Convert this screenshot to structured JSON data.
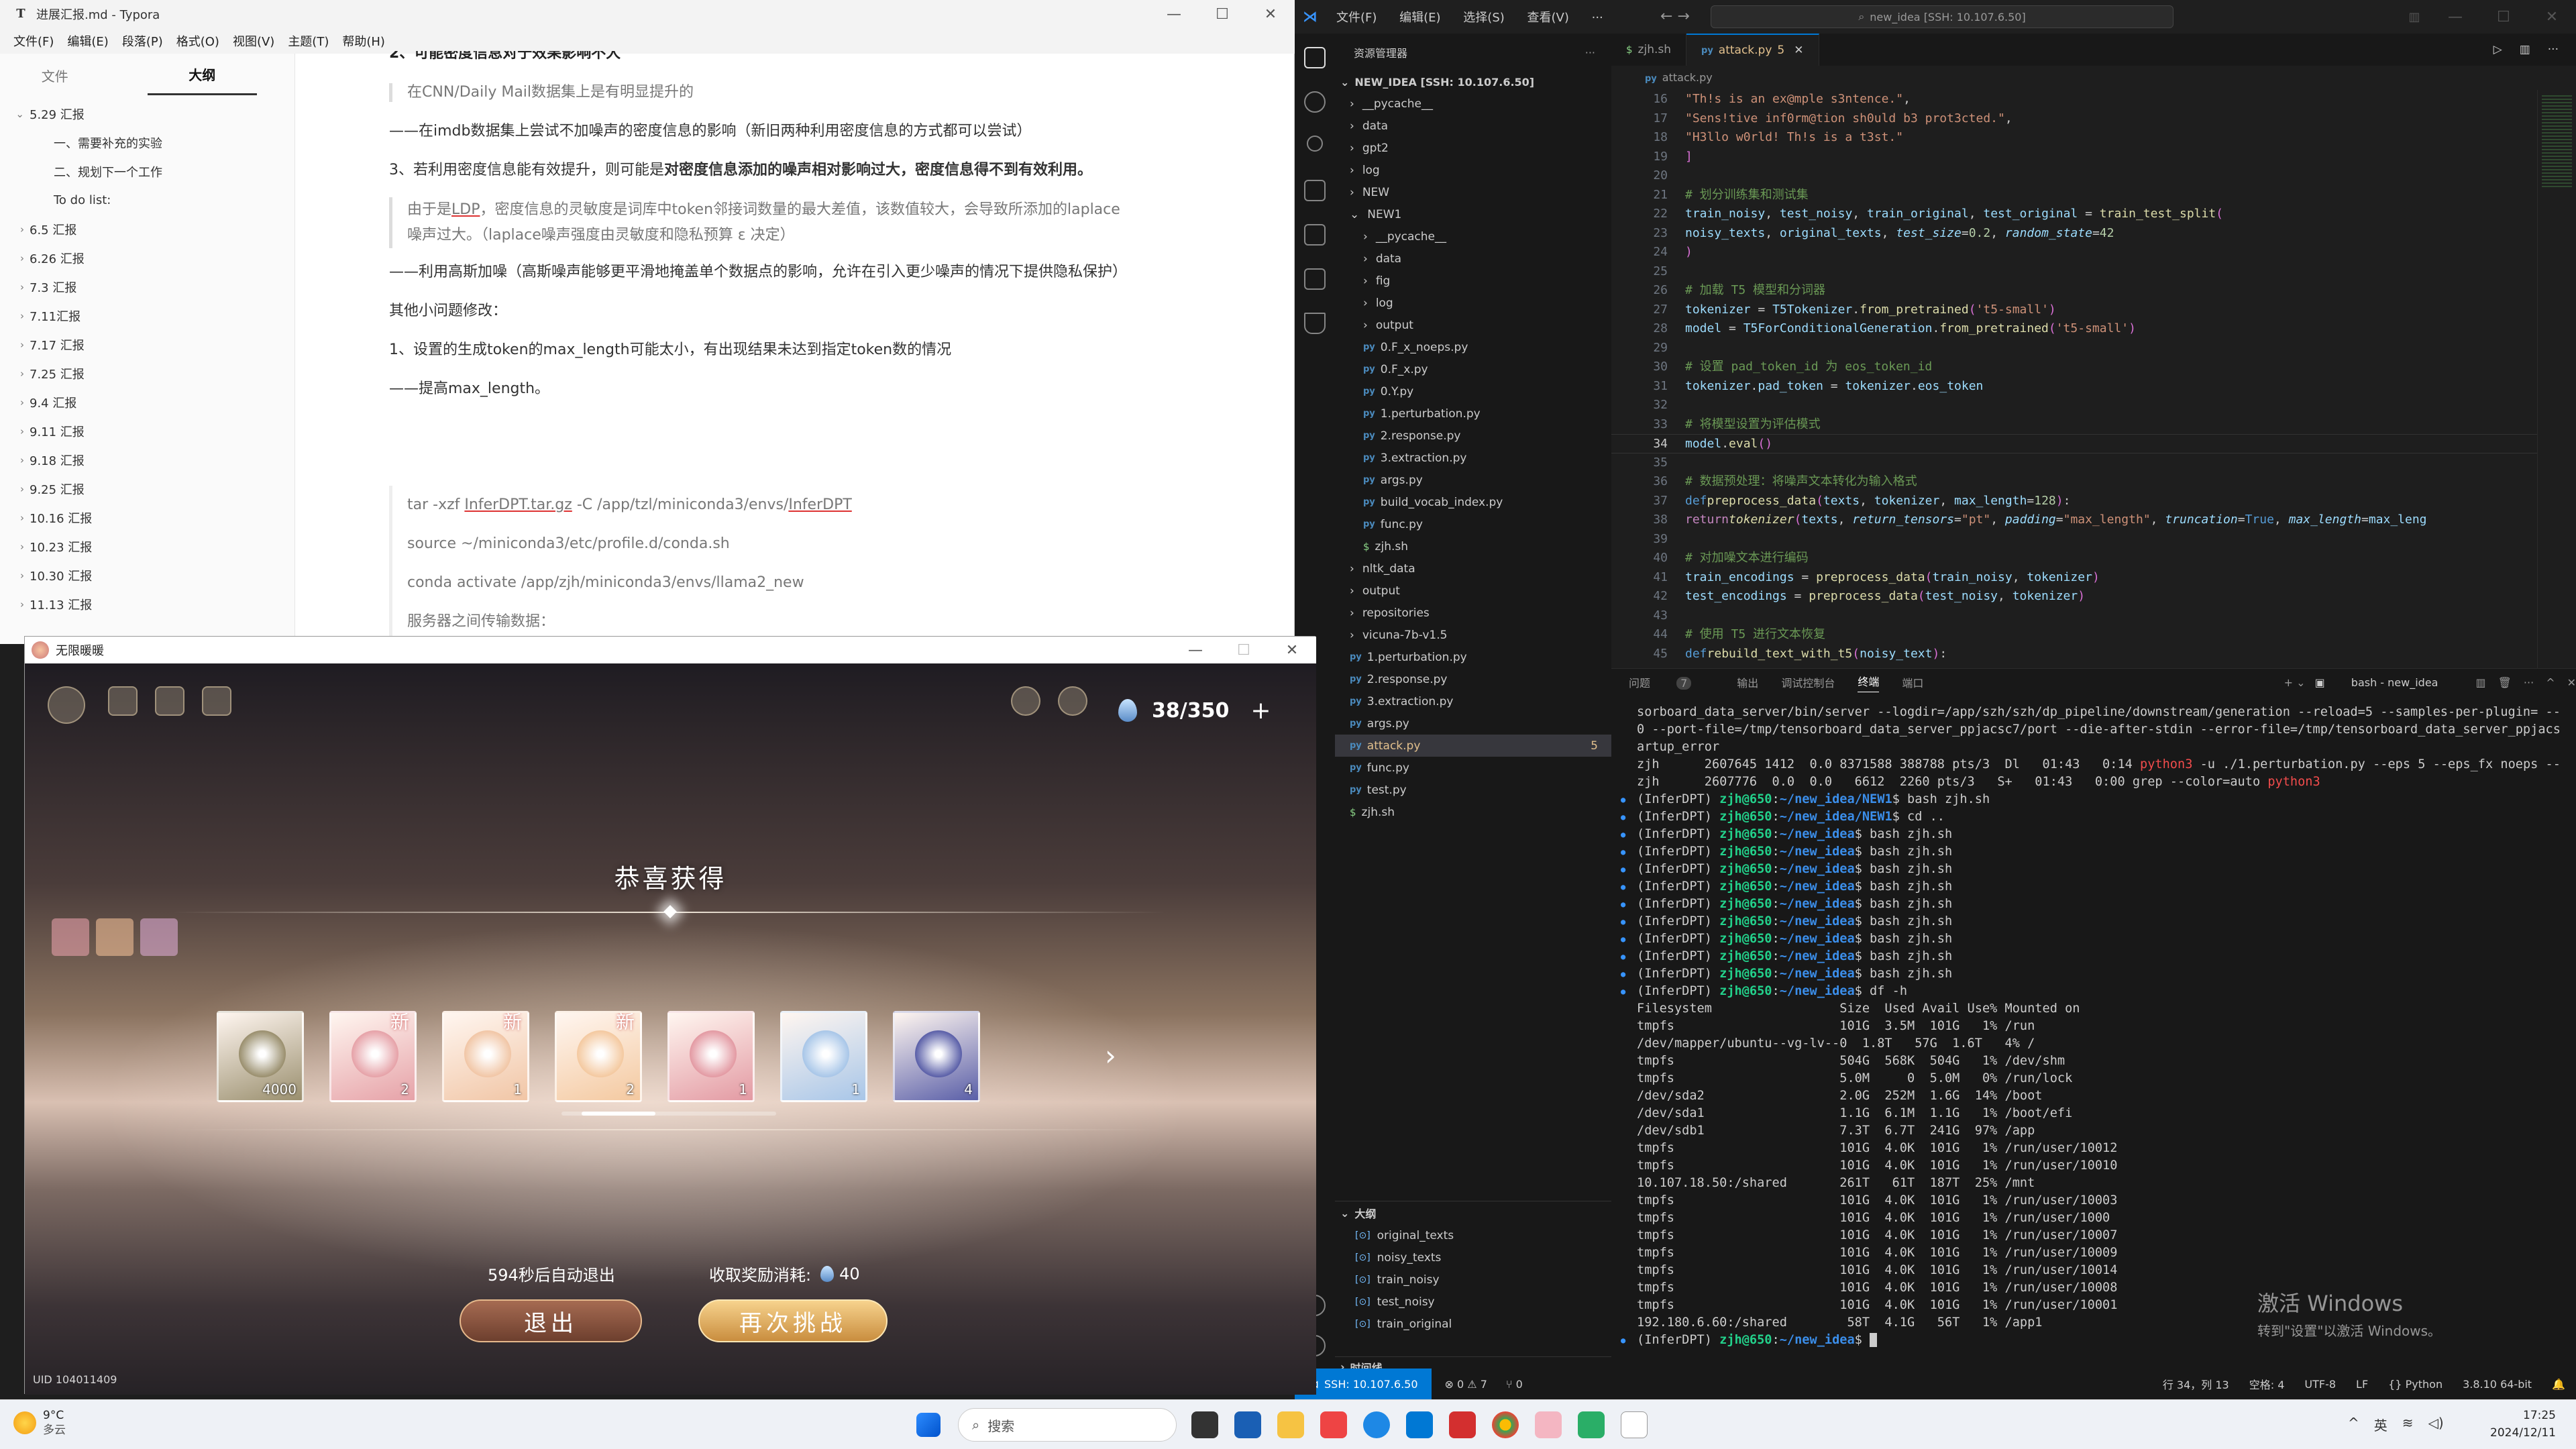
{
  "typora": {
    "title": "进展汇报.md - Typora",
    "menu": [
      "文件(F)",
      "编辑(E)",
      "段落(P)",
      "格式(O)",
      "视图(V)",
      "主题(T)",
      "帮助(H)"
    ],
    "tabs": {
      "files": "文件",
      "outline": "大纲"
    },
    "outline": [
      {
        "label": "5.29 汇报",
        "expanded": true
      },
      {
        "label": "一、需要补充的实验",
        "sub": true
      },
      {
        "label": "二、规划下一个工作",
        "sub": true
      },
      {
        "label": "To do list:",
        "sub": true,
        "plain": true
      },
      {
        "label": "6.5 汇报"
      },
      {
        "label": "6.26 汇报"
      },
      {
        "label": "7.3 汇报"
      },
      {
        "label": "7.11汇报"
      },
      {
        "label": "7.17 汇报"
      },
      {
        "label": "7.25 汇报"
      },
      {
        "label": "9.4 汇报"
      },
      {
        "label": "9.11 汇报"
      },
      {
        "label": "9.18 汇报"
      },
      {
        "label": "9.25 汇报"
      },
      {
        "label": "10.16 汇报"
      },
      {
        "label": "10.23 汇报"
      },
      {
        "label": "10.30 汇报"
      },
      {
        "label": "11.13 汇报"
      }
    ],
    "doc": {
      "h_partial": "2、可能密度信息对于效果影响不大",
      "q1": "在CNN/Daily Mail数据集上是有明显提升的",
      "p1": "——在imdb数据集上尝试不加噪声的密度信息的影响（新旧两种利用密度信息的方式都可以尝试）",
      "p2_a": "3、若利用密度信息能有效提升，则可能是",
      "p2_b": "对密度信息添加的噪声相对影响过大，密度信息得不到有效利用。",
      "q2_a": "由于是",
      "q2_ldp": "LDP",
      "q2_b": "，密度信息的灵敏度是词库中token邻接词数量的最大差值，该数值较大，会导致所添加的laplace",
      "q2_c": "噪声过大。（laplace噪声强度由灵敏度和隐私预算 ε 决定）",
      "p3": "——利用高斯加噪（高斯噪声能够更平滑地掩盖单个数据点的影响，允许在引入更少噪声的情况下提供隐私保护）",
      "p4": "其他小问题修改：",
      "p5": "1、设置的生成token的max_length可能太小，有出现结果未达到指定token数的情况",
      "p6": "——提高max_length。",
      "c1_a": "tar -xzf ",
      "c1_b": "InferDPT.tar.gz",
      "c1_c": " -C /app/tzl/miniconda3/envs/",
      "c1_d": "InferDPT",
      "c2": "source ~/miniconda3/etc/profile.d/conda.sh",
      "c3": "conda activate /app/zjh/miniconda3/envs/llama2_new",
      "c4": "服务器之间传输数据："
    }
  },
  "game": {
    "title": "无限暖暖",
    "energy": "38/350",
    "congrats": "恭喜获得",
    "items": [
      {
        "count": "4000",
        "new": false,
        "color": "#9a8f6e"
      },
      {
        "count": "2",
        "new": true,
        "color": "#e6a2a8"
      },
      {
        "count": "1",
        "new": true,
        "color": "#f1c6a6"
      },
      {
        "count": "2",
        "new": true,
        "color": "#f4c9a0"
      },
      {
        "count": "1",
        "new": false,
        "color": "#e39aa3"
      },
      {
        "count": "1",
        "new": false,
        "color": "#a8c6e8"
      },
      {
        "count": "4",
        "new": false,
        "color": "#5a5fa8"
      }
    ],
    "new_badge": "新",
    "auto_exit": "594秒后自动退出",
    "cost_label": "收取奖励消耗:",
    "cost_value": "40",
    "exit_btn": "退出",
    "retry_btn": "再次挑战",
    "uid": "UID 104011409"
  },
  "vscode": {
    "menu": [
      "文件(F)",
      "编辑(E)",
      "选择(S)",
      "查看(V)",
      "···"
    ],
    "search": "new_idea [SSH: 10.107.6.50]",
    "explorer_title": "资源管理器",
    "root": "NEW_IDEA [SSH: 10.107.6.50]",
    "tree": [
      {
        "name": "__pycache__",
        "type": "dir",
        "lvl": 0
      },
      {
        "name": "data",
        "type": "dir",
        "lvl": 0
      },
      {
        "name": "gpt2",
        "type": "dir",
        "lvl": 0
      },
      {
        "name": "log",
        "type": "dir",
        "lvl": 0
      },
      {
        "name": "NEW",
        "type": "dir",
        "lvl": 0
      },
      {
        "name": "NEW1",
        "type": "open",
        "lvl": 0
      },
      {
        "name": "__pycache__",
        "type": "dir",
        "lvl": 1
      },
      {
        "name": "data",
        "type": "dir",
        "lvl": 1
      },
      {
        "name": "fig",
        "type": "dir",
        "lvl": 1
      },
      {
        "name": "log",
        "type": "dir",
        "lvl": 1
      },
      {
        "name": "output",
        "type": "dir",
        "lvl": 1
      },
      {
        "name": "0.F_x_noeps.py",
        "type": "py",
        "lvl": 1
      },
      {
        "name": "0.F_x.py",
        "type": "py",
        "lvl": 1
      },
      {
        "name": "0.Y.py",
        "type": "py",
        "lvl": 1
      },
      {
        "name": "1.perturbation.py",
        "type": "py",
        "lvl": 1
      },
      {
        "name": "2.response.py",
        "type": "py",
        "lvl": 1
      },
      {
        "name": "3.extraction.py",
        "type": "py",
        "lvl": 1
      },
      {
        "name": "args.py",
        "type": "py",
        "lvl": 1
      },
      {
        "name": "build_vocab_index.py",
        "type": "py",
        "lvl": 1
      },
      {
        "name": "func.py",
        "type": "py",
        "lvl": 1
      },
      {
        "name": "zjh.sh",
        "type": "sh",
        "lvl": 1
      },
      {
        "name": "nltk_data",
        "type": "dir",
        "lvl": 0
      },
      {
        "name": "output",
        "type": "dir",
        "lvl": 0
      },
      {
        "name": "repositories",
        "type": "dir",
        "lvl": 0
      },
      {
        "name": "vicuna-7b-v1.5",
        "type": "dir",
        "lvl": 0
      },
      {
        "name": "1.perturbation.py",
        "type": "py",
        "lvl": 0
      },
      {
        "name": "2.response.py",
        "type": "py",
        "lvl": 0
      },
      {
        "name": "3.extraction.py",
        "type": "py",
        "lvl": 0
      },
      {
        "name": "args.py",
        "type": "py",
        "lvl": 0
      },
      {
        "name": "attack.py",
        "type": "py",
        "lvl": 0,
        "active": true,
        "badge": "5"
      },
      {
        "name": "func.py",
        "type": "py",
        "lvl": 0
      },
      {
        "name": "test.py",
        "type": "py",
        "lvl": 0
      },
      {
        "name": "zjh.sh",
        "type": "sh",
        "lvl": 0
      }
    ],
    "outline_title": "大纲",
    "outline": [
      "original_texts",
      "noisy_texts",
      "train_noisy",
      "test_noisy",
      "train_original"
    ],
    "timeline": "时间线",
    "tabs": [
      {
        "label": "zjh.sh"
      },
      {
        "label": "attack.py",
        "badge": "5",
        "active": true
      }
    ],
    "breadcrumb": "attack.py",
    "panel_tabs": [
      "问题",
      "输出",
      "调试控制台",
      "终端",
      "端口"
    ],
    "panel_badge": "7",
    "terminal_label": "bash - new_idea",
    "status": {
      "remote": "SSH: 10.107.6.50",
      "problems": "⊗ 0 ⚠ 7",
      "ports": "⑂ 0",
      "pos": "行 34，列 13",
      "spaces": "空格: 4",
      "enc": "UTF-8",
      "eol": "LF",
      "lang": "Python",
      "interp": "3.8.10 64-bit"
    },
    "activate_1": "激活 Windows",
    "activate_2": "转到\"设置\"以激活 Windows。"
  },
  "taskbar": {
    "weather_temp": "9°C",
    "weather_desc": "多云",
    "search": "搜索",
    "ime": "英",
    "time": "17:25",
    "date": "2024/12/11"
  }
}
